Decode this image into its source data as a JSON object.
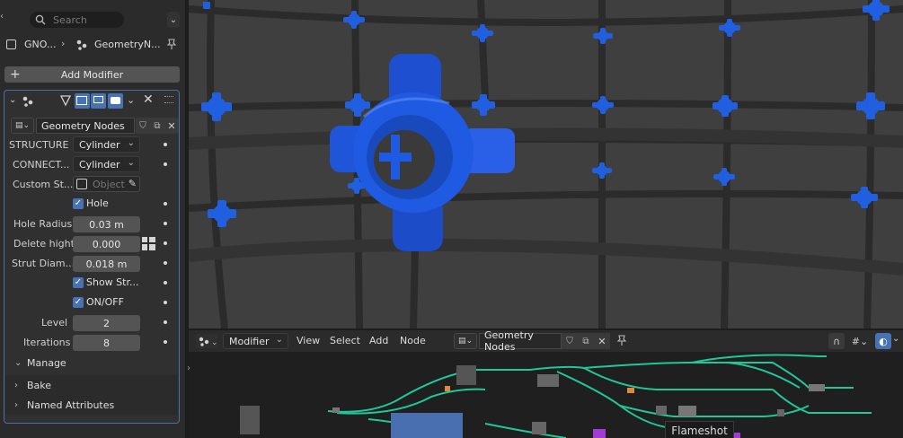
{
  "properties": {
    "search_placeholder": "Search",
    "breadcrumb": {
      "object": "GNO...",
      "modifier": "GeometryN..."
    },
    "add_modifier_label": "Add Modifier",
    "node_group": "Geometry Nodes",
    "fields": [
      {
        "label": "STRUCTURE",
        "value": "Cylinder",
        "kind": "dropdown"
      },
      {
        "label": "CONNECT...",
        "value": "Cylinder",
        "kind": "dropdown"
      },
      {
        "label": "Custom St...",
        "value": "Object",
        "kind": "object"
      },
      {
        "label": "Hole",
        "value": "",
        "kind": "checkbox"
      },
      {
        "label": "Hole Radius",
        "value": "0.03 m",
        "kind": "number"
      },
      {
        "label": "Delete hight",
        "value": "0.000",
        "kind": "number"
      },
      {
        "label": "Strut Diam...",
        "value": "0.018 m",
        "kind": "number"
      },
      {
        "label": "Show Str...",
        "value": "",
        "kind": "checkbox"
      },
      {
        "label": "ON/OFF",
        "value": "",
        "kind": "checkbox"
      },
      {
        "label": "Level",
        "value": "2",
        "kind": "number"
      },
      {
        "label": "Iterations",
        "value": "8",
        "kind": "number"
      }
    ],
    "panels": {
      "manage": "Manage",
      "bake": "Bake",
      "named_attributes": "Named Attributes"
    }
  },
  "node_editor": {
    "editor_type": "Modifier",
    "menus": [
      "View",
      "Select",
      "Add",
      "Node"
    ],
    "node_group": "Geometry Nodes",
    "tooltip": "Flameshot"
  },
  "colors": {
    "accent": "#4772b3",
    "connector_blue": "#1f5fe0",
    "wire_green": "#1fc79a"
  }
}
